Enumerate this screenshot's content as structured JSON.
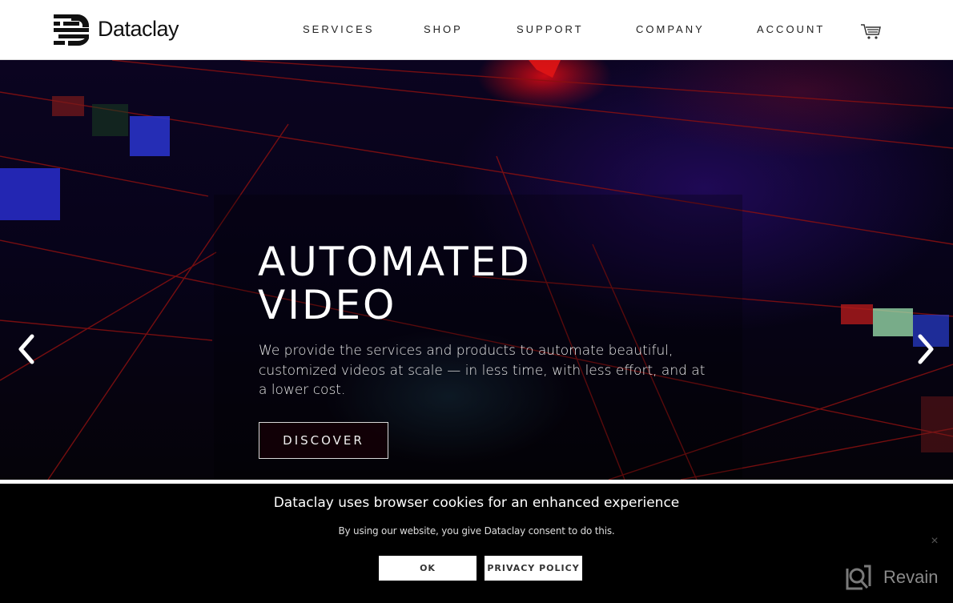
{
  "header": {
    "brand": "Dataclay",
    "nav": [
      {
        "label": "SERVICES"
      },
      {
        "label": "SHOP"
      },
      {
        "label": "SUPPORT"
      },
      {
        "label": "COMPANY"
      },
      {
        "label": "ACCOUNT"
      }
    ],
    "cart_icon": "shopping-cart-icon"
  },
  "hero": {
    "title_line1": "AUTOMATED",
    "title_line2": "VIDEO",
    "description": "We provide the services and products to automate beautiful, customized videos at scale — in less time, with less effort, and at a lower cost.",
    "cta_label": "DISCOVER",
    "prev_icon": "chevron-left-icon",
    "next_icon": "chevron-right-icon"
  },
  "cookie_banner": {
    "title": "Dataclay uses browser cookies for an enhanced experience",
    "text": "By using our website, you give Dataclay consent to do this.",
    "ok_label": "OK",
    "privacy_label": "PRIVACY POLICY",
    "close_symbol": "×"
  },
  "watermark": {
    "label": "Revain"
  },
  "colors": {
    "header_bg": "#ffffff",
    "hero_bg": "#07031a",
    "cookie_bg": "#000000",
    "grid_line": "#8a1010"
  }
}
